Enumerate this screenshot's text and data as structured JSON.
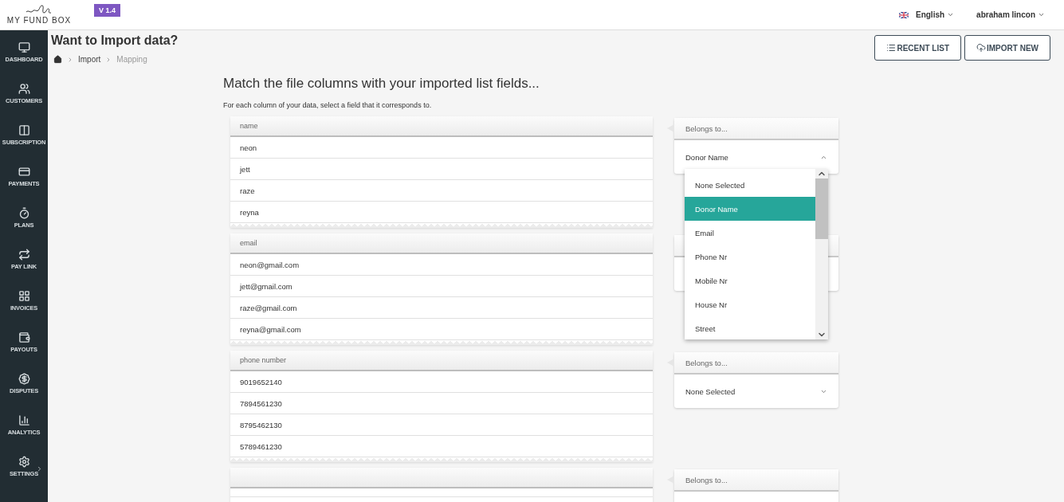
{
  "brand": {
    "name": "MY FUND BOX",
    "version": "V 1.4"
  },
  "topbar": {
    "language": "English",
    "user": "abraham lincon"
  },
  "sidebar": {
    "items": [
      {
        "label": "DASHBOARD",
        "submenu": false
      },
      {
        "label": "CUSTOMERS",
        "submenu": false
      },
      {
        "label": "SUBSCRIPTION",
        "submenu": false
      },
      {
        "label": "PAYMENTS",
        "submenu": false
      },
      {
        "label": "PLANS",
        "submenu": false
      },
      {
        "label": "PAY LINK",
        "submenu": false
      },
      {
        "label": "INVOICES",
        "submenu": false
      },
      {
        "label": "PAYOUTS",
        "submenu": false
      },
      {
        "label": "DISPUTES",
        "submenu": false
      },
      {
        "label": "ANALYTICS",
        "submenu": false
      },
      {
        "label": "SETTINGS",
        "submenu": true
      }
    ]
  },
  "page": {
    "title": "Want to Import data?",
    "breadcrumb": [
      "Import",
      "Mapping"
    ],
    "buttons": [
      "RECENT LIST",
      "IMPORT NEW"
    ]
  },
  "mapping": {
    "title": "Match the file columns with your imported list fields...",
    "subtitle": "For each column of your data, select a field that it corresponds to.",
    "groups": [
      {
        "header": "name",
        "rows": [
          "neon",
          "jett",
          "raze",
          "reyna"
        ],
        "field": {
          "label": "Belongs to...",
          "value": "Donor Name",
          "open": true,
          "options": [
            {
              "label": "None Selected",
              "selected": false
            },
            {
              "label": "Donor Name",
              "selected": true
            },
            {
              "label": "Email",
              "selected": false
            },
            {
              "label": "Phone Nr",
              "selected": false
            },
            {
              "label": "Mobile Nr",
              "selected": false
            },
            {
              "label": "House Nr",
              "selected": false
            },
            {
              "label": "Street",
              "selected": false
            }
          ]
        }
      },
      {
        "header": "email",
        "rows": [
          "neon@gmail.com",
          "jett@gmail.com",
          "raze@gmail.com",
          "reyna@gmail.com"
        ]
      },
      {
        "header": "phone number",
        "rows": [
          "9019652140",
          "7894561230",
          "8795462130",
          "5789461230"
        ],
        "field": {
          "label": "Belongs to...",
          "value": "None Selected",
          "open": false
        }
      },
      {
        "field": {
          "label": "Belongs to..."
        }
      }
    ]
  }
}
